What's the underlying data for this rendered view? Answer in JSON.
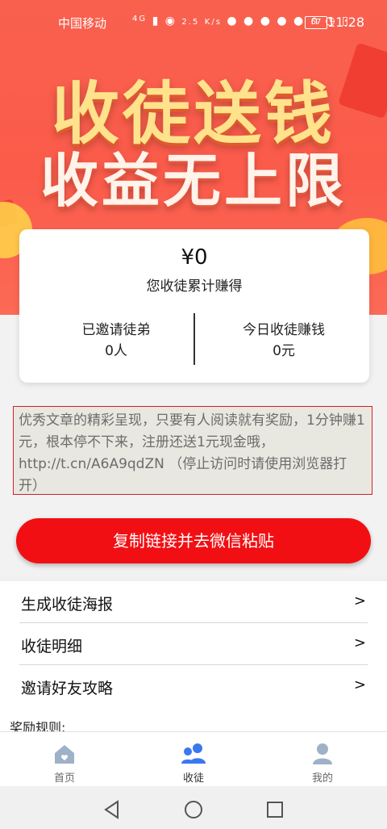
{
  "status_bar": {
    "carrier": "中国移动",
    "network": "4G",
    "speed_value": "2.5",
    "speed_unit": "K/s",
    "battery": "67",
    "time": "11:28"
  },
  "hero": {
    "headline_1": "收徒送钱",
    "headline_2": "收益无上限"
  },
  "earnings_card": {
    "amount": "¥0",
    "amount_label": "您收徒累计赚得",
    "invited_label": "已邀请徒弟",
    "invited_value": "0人",
    "today_label": "今日收徒赚钱",
    "today_value": "0元"
  },
  "promo_text": "优秀文章的精彩呈现，只要有人阅读就有奖励，1分钟赚1元，根本停不下来，注册还送1元现金哦，http://t.cn/A6A9qdZN （停止访问时请使用浏览器打开）",
  "copy_button": "复制链接并去微信粘贴",
  "menu": [
    {
      "label": "生成收徒海报",
      "arrow": ">"
    },
    {
      "label": "收徒明细",
      "arrow": ">"
    },
    {
      "label": "邀请好友攻略",
      "arrow": ">"
    }
  ],
  "rules_title": "奖励规则:",
  "tabs": [
    {
      "label": "首页",
      "icon": "home-icon"
    },
    {
      "label": "收徒",
      "icon": "users-icon",
      "active": true
    },
    {
      "label": "我的",
      "icon": "profile-icon"
    }
  ],
  "colors": {
    "primary_red": "#f20f13",
    "hero_red": "#fb5b4a",
    "active_tab_blue": "#3a78ee",
    "inactive_tab_gray": "#9fb1c8"
  }
}
